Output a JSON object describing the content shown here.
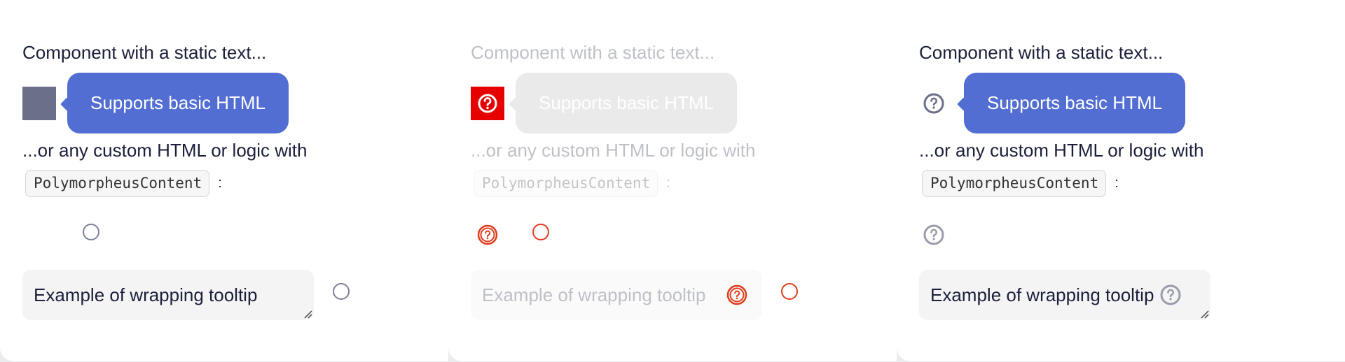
{
  "columns": [
    {
      "static_text": "Component with a static text...",
      "hint_text": "Supports basic HTML",
      "custom_text": "...or any custom HTML or logic with",
      "code_label": "PolymorpheusContent",
      "colon": ":",
      "textarea_value": "Example of wrapping tooltip"
    },
    {
      "static_text": "Component with a static text...",
      "hint_text": "Supports basic HTML",
      "custom_text": "...or any custom HTML or logic with",
      "code_label": "PolymorpheusContent",
      "colon": ":",
      "textarea_value": "Example of wrapping tooltip"
    },
    {
      "static_text": "Component with a static text...",
      "hint_text": "Supports basic HTML",
      "custom_text": "...or any custom HTML or logic with",
      "code_label": "PolymorpheusContent",
      "colon": ":",
      "textarea_value": "Example of wrapping tooltip"
    }
  ],
  "icons": {
    "tooltip": "question-circle-icon",
    "placeholder": "ring-icon",
    "resize": "resize-handle-icon"
  },
  "colors": {
    "hint_bg": "#526ed3",
    "icon_gray": "#7d8096",
    "highlight_red": "#e60000",
    "outline_red": "#e13c1c"
  }
}
